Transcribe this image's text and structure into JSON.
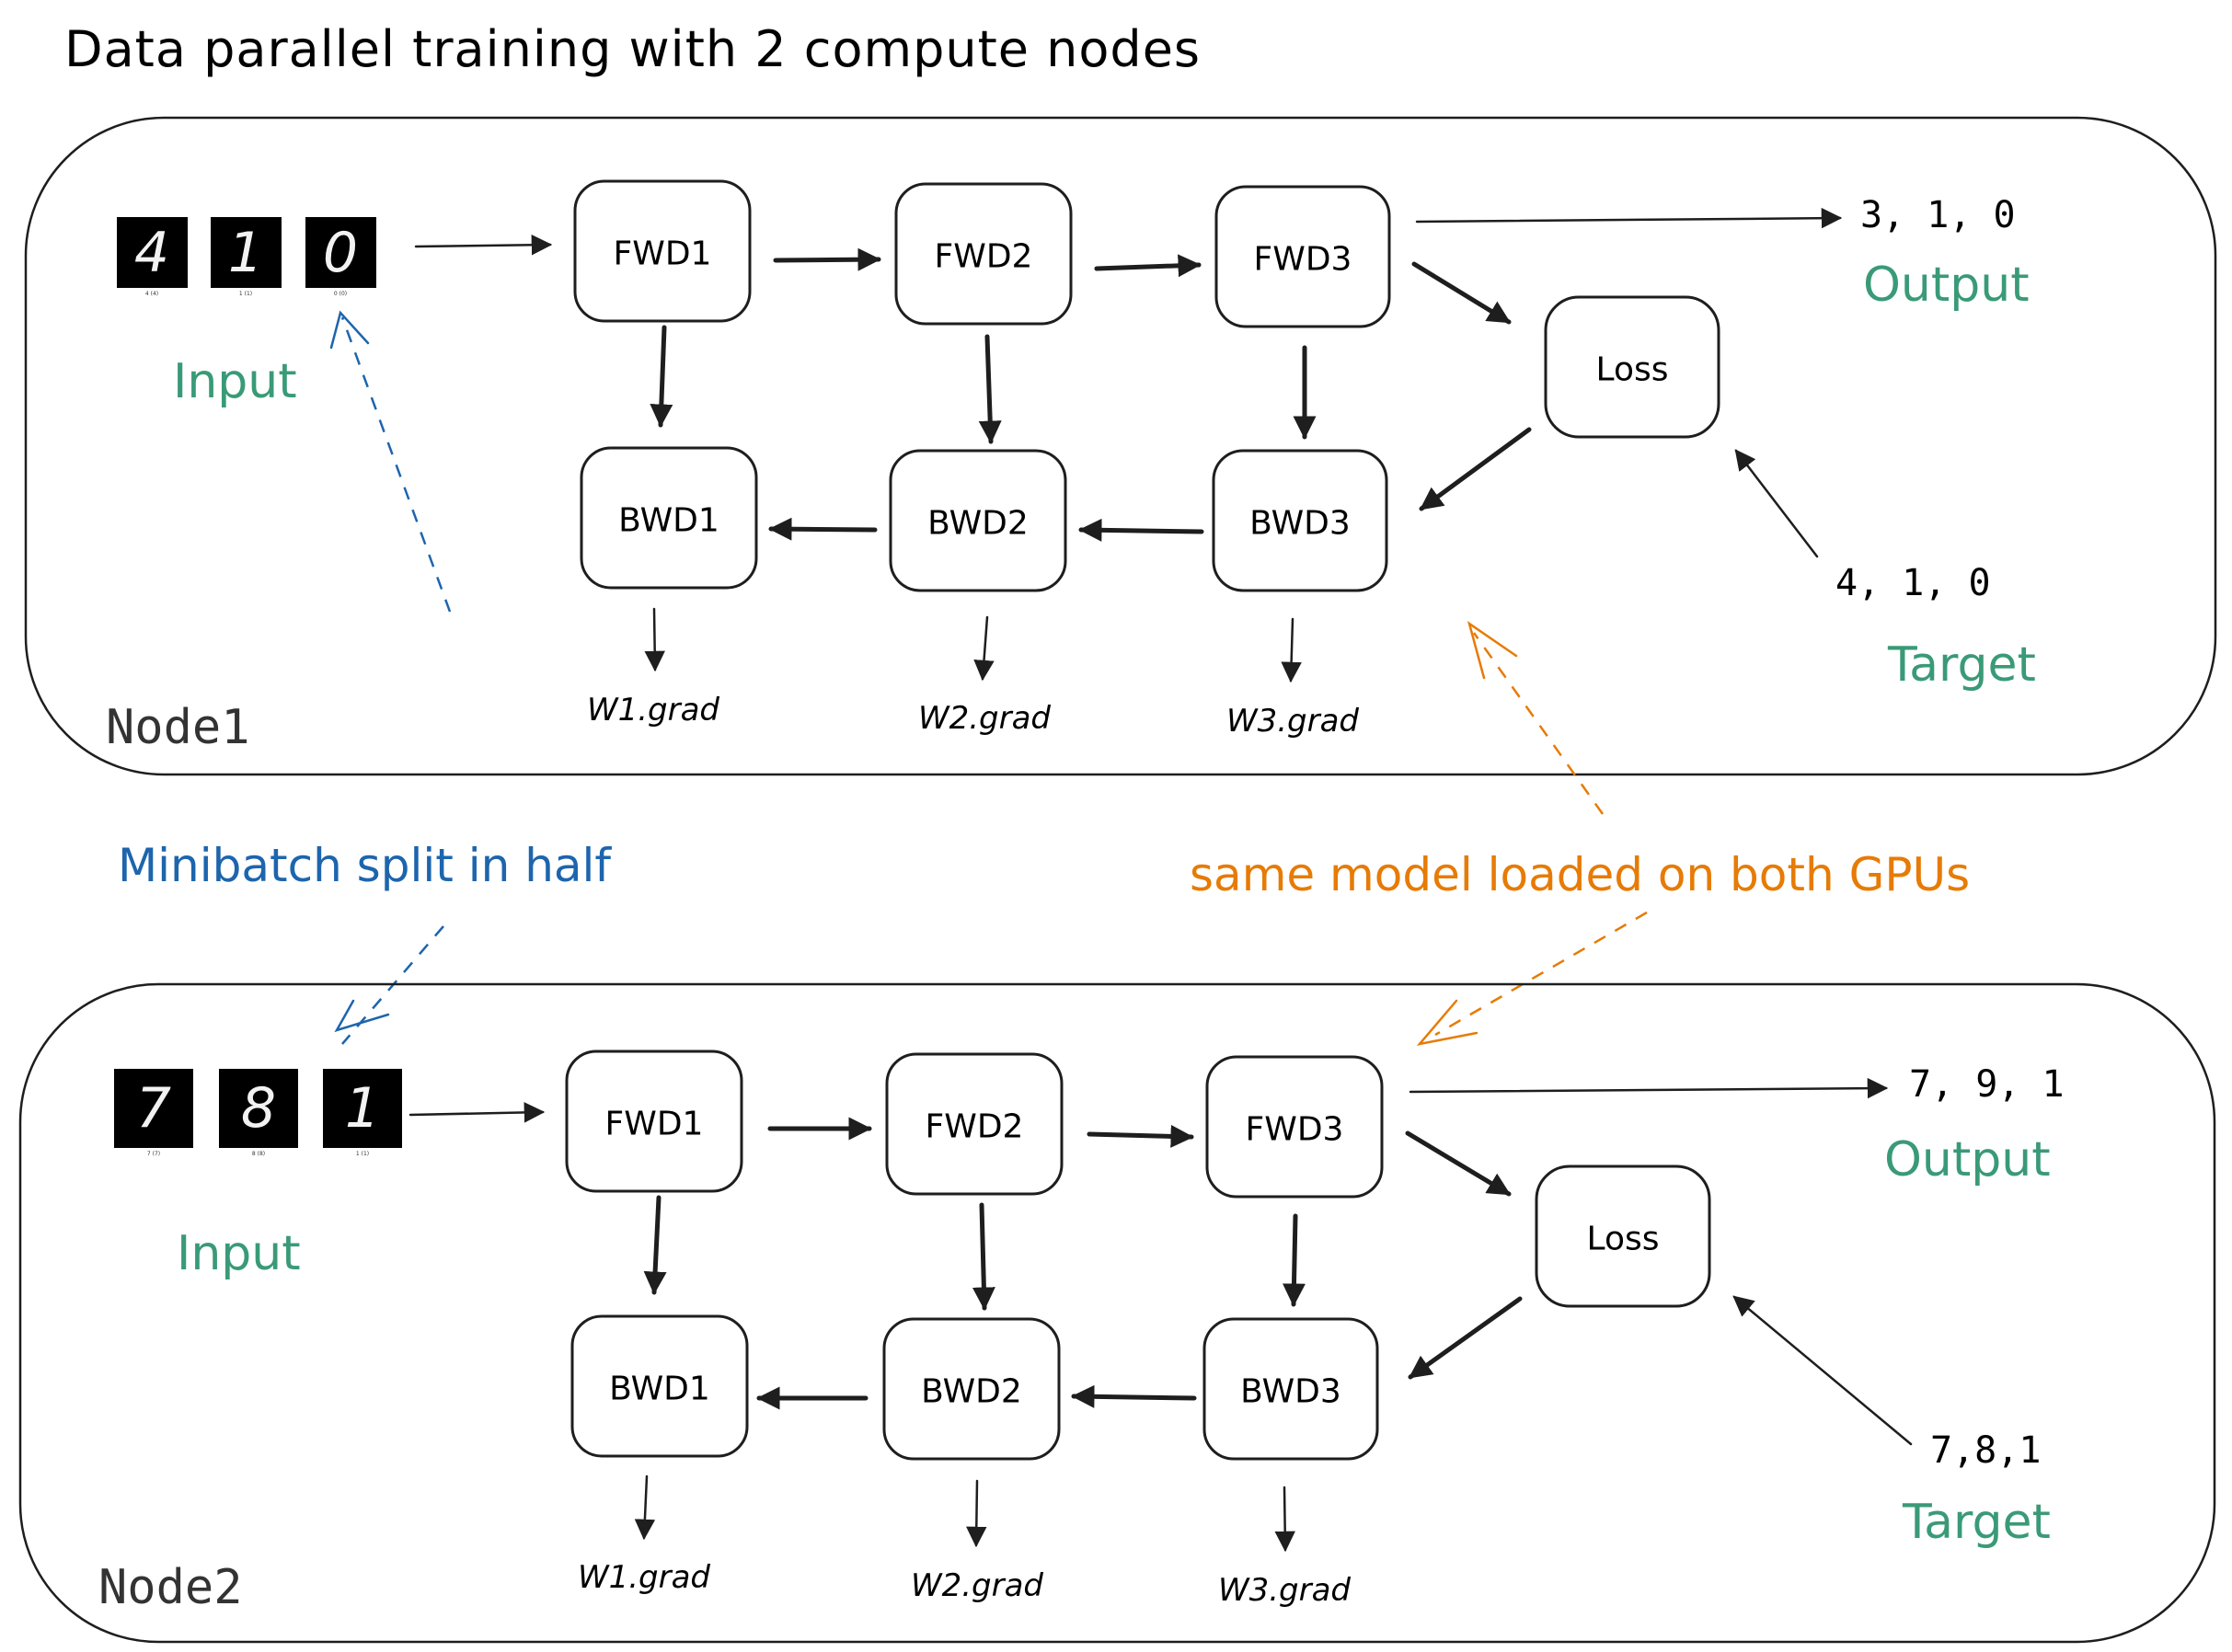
{
  "title": "Data parallel training with 2 compute nodes",
  "colors": {
    "stroke": "#1e1e1e",
    "label_green": "#3a9a78",
    "annotation_blue": "#1d65ad",
    "annotation_orange": "#e67b06",
    "node_label": "#333333"
  },
  "annotations": {
    "minibatch": "Minibatch split in half",
    "same_model": "same model loaded on both GPUs"
  },
  "nodes": [
    {
      "label": "Node1",
      "input_label": "Input",
      "input_images": [
        {
          "digit": "4",
          "caption": "4 (4)"
        },
        {
          "digit": "1",
          "caption": "1 (1)"
        },
        {
          "digit": "0",
          "caption": "0 (0)"
        }
      ],
      "forward": [
        "FWD1",
        "FWD2",
        "FWD3"
      ],
      "backward": [
        "BWD1",
        "BWD2",
        "BWD3"
      ],
      "loss": "Loss",
      "grads": [
        "W1.grad",
        "W2.grad",
        "W3.grad"
      ],
      "output_values": "3, 1, 0",
      "output_label": "Output",
      "target_values": "4, 1, 0",
      "target_label": "Target"
    },
    {
      "label": "Node2",
      "input_label": "Input",
      "input_images": [
        {
          "digit": "7",
          "caption": "7 (7)"
        },
        {
          "digit": "8",
          "caption": "8 (8)"
        },
        {
          "digit": "1",
          "caption": "1 (1)"
        }
      ],
      "forward": [
        "FWD1",
        "FWD2",
        "FWD3"
      ],
      "backward": [
        "BWD1",
        "BWD2",
        "BWD3"
      ],
      "loss": "Loss",
      "grads": [
        "W1.grad",
        "W2.grad",
        "W3.grad"
      ],
      "output_values": "7, 9, 1",
      "output_label": "Output",
      "target_values": "7,8,1",
      "target_label": "Target"
    }
  ]
}
